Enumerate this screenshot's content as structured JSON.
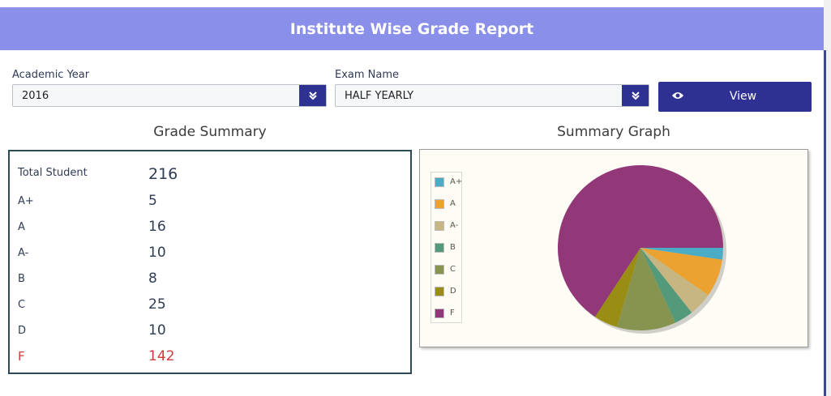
{
  "header": {
    "title": "Institute Wise Grade Report"
  },
  "filters": {
    "academic_year": {
      "label": "Academic Year",
      "value": "2016"
    },
    "exam_name": {
      "label": "Exam Name",
      "value": "HALF YEARLY"
    },
    "view_label": "View"
  },
  "summary": {
    "title": "Grade Summary",
    "rows": [
      {
        "name": "Total Student",
        "value": "216"
      },
      {
        "name": "A+",
        "value": "5"
      },
      {
        "name": "A",
        "value": "16"
      },
      {
        "name": "A-",
        "value": "10"
      },
      {
        "name": "B",
        "value": "8"
      },
      {
        "name": "C",
        "value": "25"
      },
      {
        "name": "D",
        "value": "10"
      },
      {
        "name": "F",
        "value": "142"
      }
    ]
  },
  "graph": {
    "title": "Summary Graph"
  },
  "chart_data": {
    "type": "pie",
    "categories": [
      "A+",
      "A",
      "A-",
      "B",
      "C",
      "D",
      "F"
    ],
    "values": [
      5,
      16,
      10,
      8,
      25,
      10,
      142
    ],
    "colors": [
      "#4bacc6",
      "#eba230",
      "#c7b582",
      "#529a7a",
      "#87944f",
      "#9a8d13",
      "#923778"
    ],
    "legend": "left"
  },
  "icons": {
    "dropdown": "chevron-down-icon",
    "view": "eye-icon"
  }
}
